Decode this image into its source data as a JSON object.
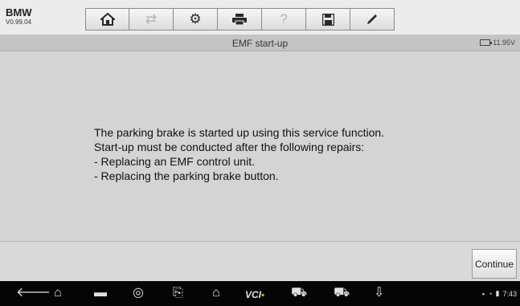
{
  "header": {
    "make": "BMW",
    "version": "V0.99.04"
  },
  "toolbar": {
    "buttons": [
      {
        "name": "home",
        "icon": "home-icon"
      },
      {
        "name": "vehicle-swap",
        "icon": "vehicle-swap-icon",
        "disabled": true
      },
      {
        "name": "settings",
        "icon": "gear-icon"
      },
      {
        "name": "print",
        "icon": "printer-icon"
      },
      {
        "name": "help",
        "icon": "help-icon",
        "disabled": true
      },
      {
        "name": "save",
        "icon": "save-icon"
      },
      {
        "name": "edit",
        "icon": "pen-icon"
      }
    ]
  },
  "title_bar": {
    "title": "EMF start-up",
    "battery_voltage": "11.95V"
  },
  "message": {
    "lines": [
      "The parking brake is started up using this service function.",
      "Start-up must be conducted after the following repairs:",
      "- Replacing an EMF control unit.",
      "- Replacing the parking brake button."
    ]
  },
  "actions": {
    "continue_label": "Continue"
  },
  "navbar": {
    "vci_label": "VCI",
    "clock": "7:43"
  }
}
